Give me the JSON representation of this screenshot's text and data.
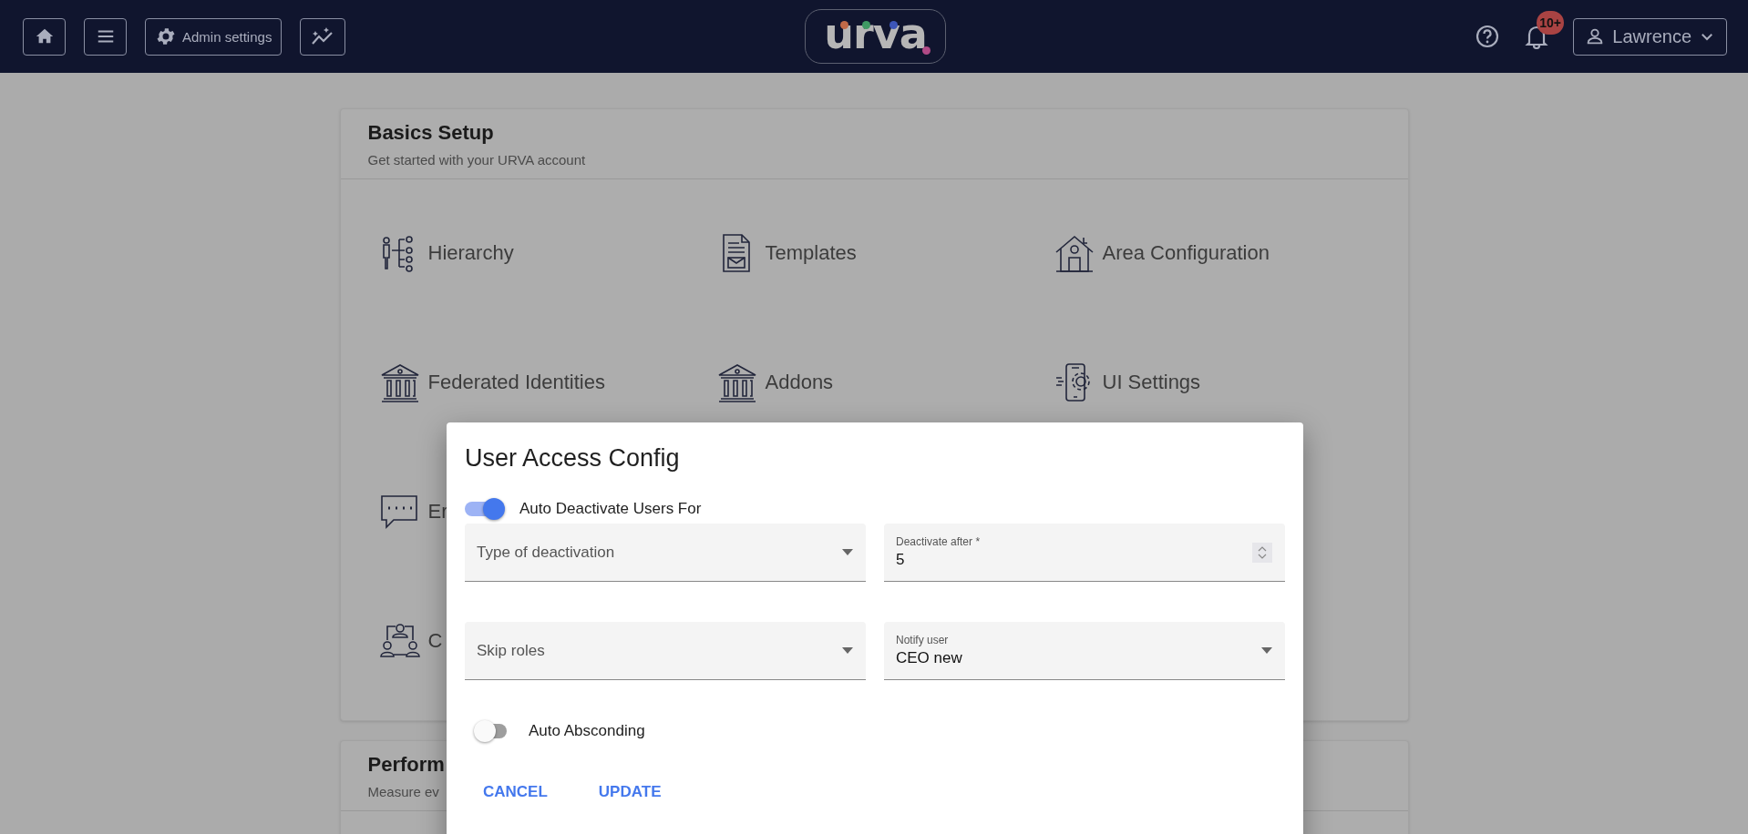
{
  "header": {
    "buttons": [
      {
        "kind": "home"
      },
      {
        "kind": "menu"
      },
      {
        "kind": "settings",
        "label": "Admin settings"
      },
      {
        "kind": "insights"
      }
    ],
    "logo": "urva",
    "notifications_badge": "10+",
    "user": "Lawrence"
  },
  "basics_card": {
    "title": "Basics Setup",
    "subtitle": "Get started with your URVA account",
    "items": [
      {
        "kind": "hierarchy",
        "label": "Hierarchy"
      },
      {
        "kind": "template",
        "label": "Templates"
      },
      {
        "kind": "house",
        "label": "Area Configuration"
      },
      {
        "kind": "bank",
        "label": "Federated Identities"
      },
      {
        "kind": "bank",
        "label": "Addons"
      },
      {
        "kind": "phone-gear",
        "label": "UI Settings"
      },
      {
        "kind": "chat",
        "label": "Er"
      },
      {
        "kind": "team",
        "label": "C"
      }
    ]
  },
  "performance_card": {
    "title": "Perform",
    "subtitle": "Measure ev"
  },
  "dialog": {
    "title": "User Access Config",
    "deactivate_toggle": {
      "label": "Auto Deactivate Users For",
      "on": true
    },
    "fields": [
      {
        "kind": "select",
        "placeholder": "Type of deactivation"
      },
      {
        "kind": "number",
        "label": "Deactivate after *",
        "value": "5"
      },
      {
        "kind": "select",
        "placeholder": "Skip roles"
      },
      {
        "kind": "select",
        "label": "Notify user",
        "value": "CEO new"
      }
    ],
    "absconding_toggle": {
      "label": "Auto Absconding",
      "on": false
    },
    "actions": [
      "CANCEL",
      "UPDATE"
    ]
  }
}
